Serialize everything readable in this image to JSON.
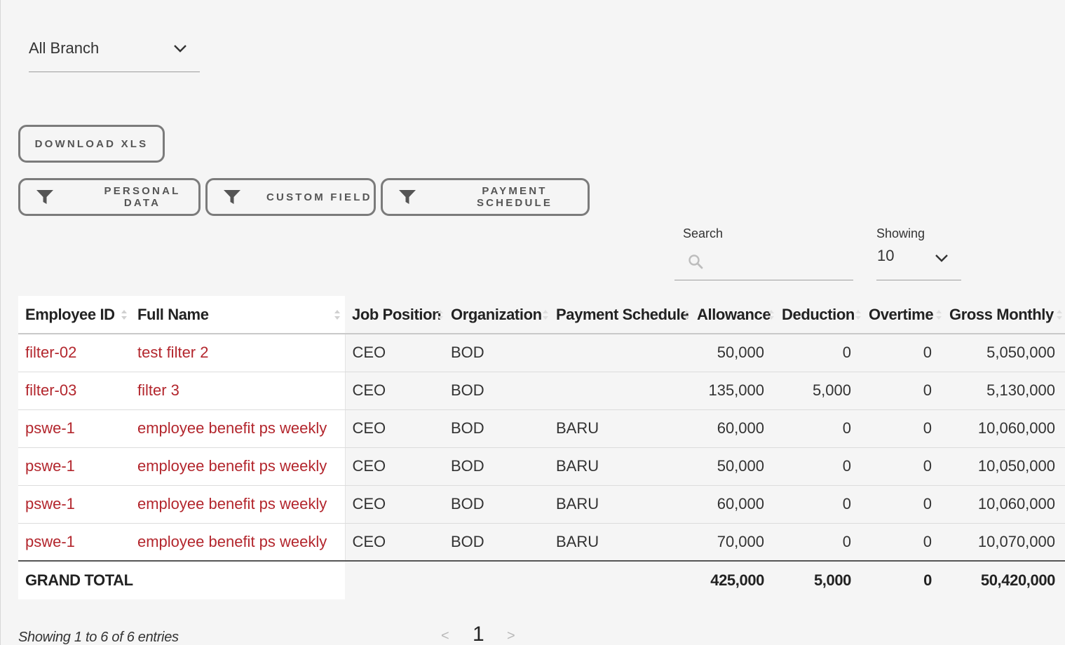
{
  "branch_filter": {
    "value": "All Branch"
  },
  "buttons": {
    "download": "DOWNLOAD XLS",
    "personal_data": "PERSONAL DATA",
    "custom_field": "CUSTOM FIELD",
    "payment_schedule": "PAYMENT SCHEDULE"
  },
  "search": {
    "label": "Search",
    "value": "",
    "placeholder": ""
  },
  "showing": {
    "label": "Showing",
    "value": "10"
  },
  "table": {
    "columns": [
      "Employee ID",
      "Full Name",
      "Job Position",
      "Organization",
      "Payment Schedule",
      "Allowance",
      "Deduction",
      "Overtime",
      "Gross Monthly"
    ],
    "rows": [
      [
        "filter-02",
        "test filter 2",
        "CEO",
        "BOD",
        "",
        "50,000",
        "0",
        "0",
        "5,050,000"
      ],
      [
        "filter-03",
        "filter 3",
        "CEO",
        "BOD",
        "",
        "135,000",
        "5,000",
        "0",
        "5,130,000"
      ],
      [
        "pswe-1",
        "employee benefit ps weekly",
        "CEO",
        "BOD",
        "BARU",
        "60,000",
        "0",
        "0",
        "10,060,000"
      ],
      [
        "pswe-1",
        "employee benefit ps weekly",
        "CEO",
        "BOD",
        "BARU",
        "50,000",
        "0",
        "0",
        "10,050,000"
      ],
      [
        "pswe-1",
        "employee benefit ps weekly",
        "CEO",
        "BOD",
        "BARU",
        "60,000",
        "0",
        "0",
        "10,060,000"
      ],
      [
        "pswe-1",
        "employee benefit ps weekly",
        "CEO",
        "BOD",
        "BARU",
        "70,000",
        "0",
        "0",
        "10,070,000"
      ]
    ],
    "total": {
      "label": "GRAND TOTAL",
      "allowance": "425,000",
      "deduction": "5,000",
      "overtime": "0",
      "gross_monthly": "50,420,000"
    }
  },
  "footer": {
    "entries": "Showing 1 to 6 of 6 entries",
    "prev": "<",
    "page": "1",
    "next": ">"
  },
  "colors": {
    "link": "#b3262d",
    "button_border": "#7b7b7b",
    "background": "#f5f5f5"
  },
  "icons": {
    "branch_chevron": "chevron-down-icon",
    "filter": "funnel-icon",
    "search": "search-icon",
    "sort": "sort-arrows-icon"
  }
}
